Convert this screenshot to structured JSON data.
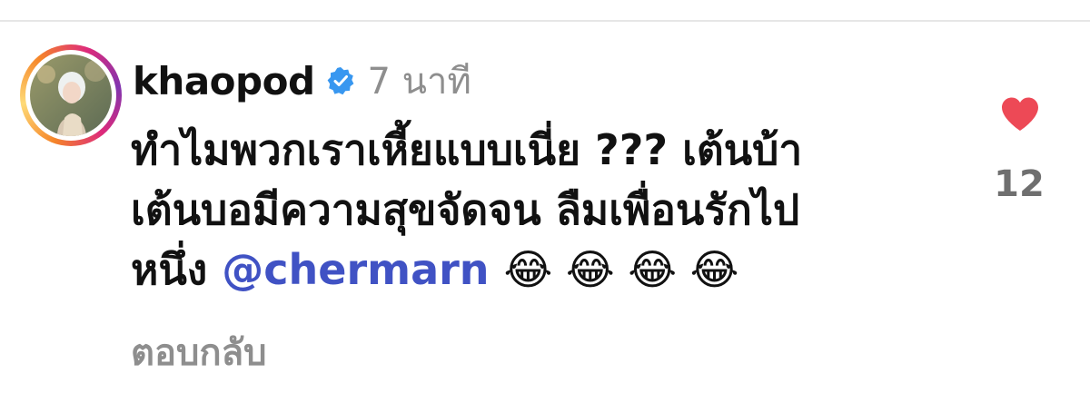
{
  "comment": {
    "username": "khaopod",
    "verified_icon": "verified-badge-icon",
    "timestamp": "7 นาที",
    "text_lines": [
      "ทำไมพวกเราเหี้ยแบบเนี่ย ??? เต้นบ้า",
      "เต้นบอมีความสุขจัดจน ลืมเพื่อนรักไป"
    ],
    "line3_prefix": "หนึ่ง",
    "mention": "@chermarn",
    "emojis": "😂 😂 😂 😂",
    "reply_label": "ตอบกลับ",
    "like_icon": "heart-icon",
    "like_count": "12"
  },
  "colors": {
    "like_heart": "#ed4956",
    "mention": "#4052c4",
    "verified": "#3897f0",
    "muted_text": "#8e8e8e"
  }
}
